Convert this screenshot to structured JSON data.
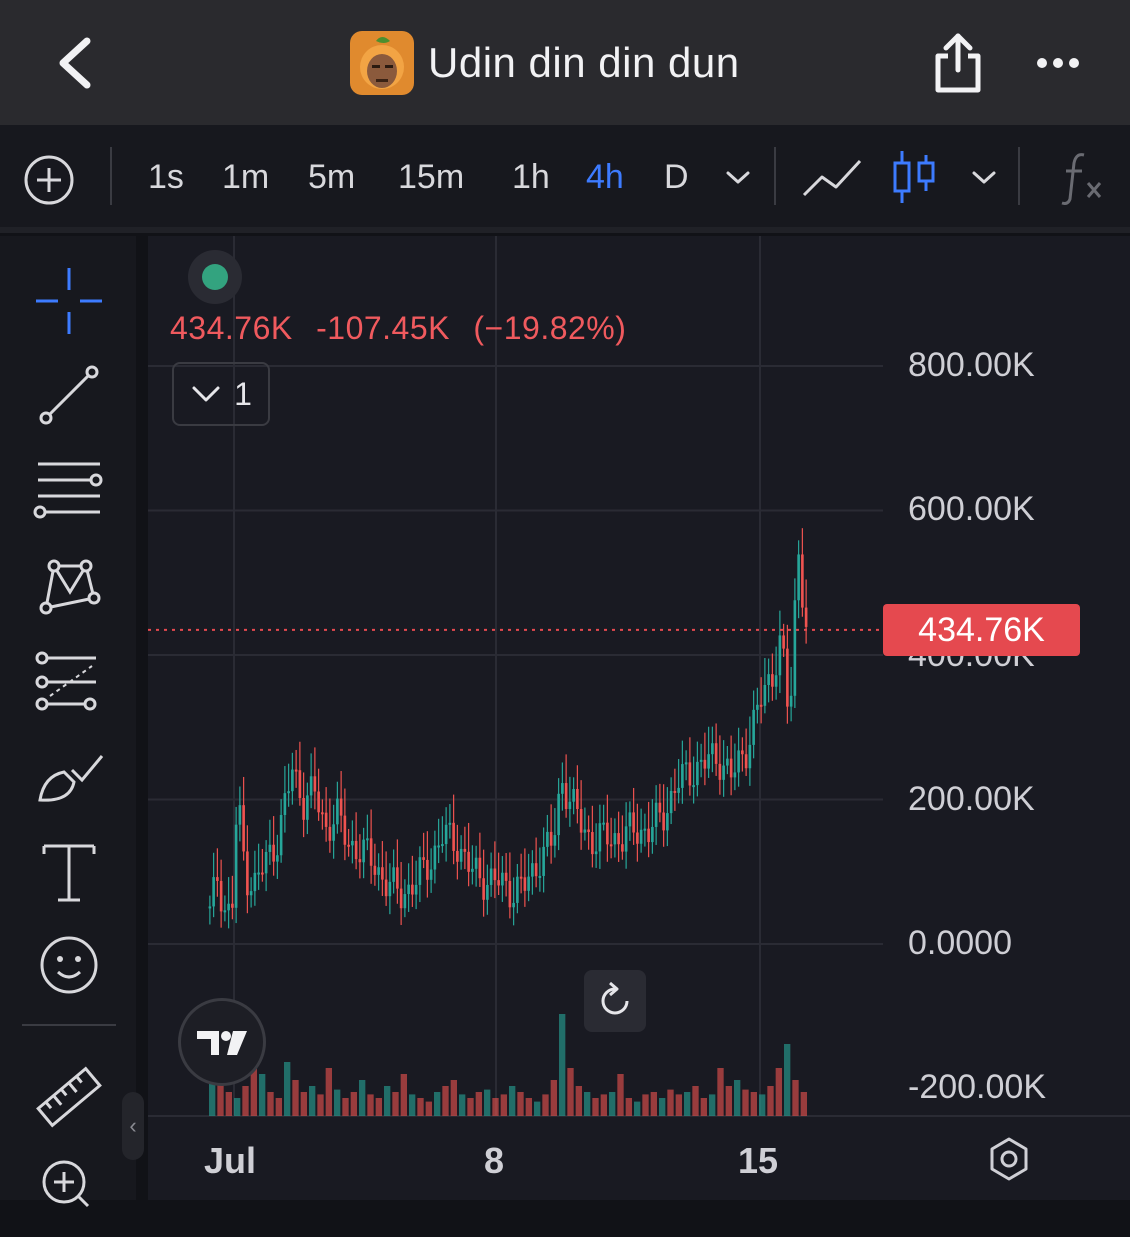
{
  "header": {
    "title": "Udin din din dun"
  },
  "icons": {
    "back": "chevron-left-icon",
    "share": "share-icon",
    "more": "more-dots-icon",
    "add_indicator": "plus-circle-icon",
    "line_chart": "line-chart-icon",
    "candles": "candlestick-icon",
    "formula": "fx-icon"
  },
  "toolbar": {
    "timeframes": [
      "1s",
      "1m",
      "5m",
      "15m",
      "1h",
      "4h",
      "D"
    ],
    "active_timeframe": "4h"
  },
  "left_tools": [
    "crosshair-icon",
    "trend-line-icon",
    "horizontal-lines-icon",
    "pattern-icon",
    "fib-tool-icon",
    "brush-icon",
    "text-tool-icon",
    "emoji-icon",
    "ruler-icon",
    "zoom-in-icon"
  ],
  "legend": {
    "price": "434.76K",
    "change": "-107.45K",
    "change_pct": "(−19.82%)",
    "series_count": "1"
  },
  "colors": {
    "up": "#26a69a",
    "down": "#ef5350",
    "accent": "#3d7bff",
    "price_tag": "#e5494f"
  },
  "chart_data": {
    "type": "candlestick",
    "last_price": 434760,
    "last_price_label": "434.76K",
    "y_ticks": [
      "800.00K",
      "600.00K",
      "400.00K",
      "200.00K",
      "0.0000",
      "-200.00K"
    ],
    "x_ticks": [
      "Jul",
      "8",
      "15"
    ],
    "ylim": [
      -200000,
      800000
    ],
    "close_path": [
      [
        0,
        40000
      ],
      [
        3,
        100000
      ],
      [
        5,
        50000
      ],
      [
        8,
        40000
      ],
      [
        10,
        200000
      ],
      [
        13,
        100000
      ],
      [
        16,
        80000
      ],
      [
        20,
        110000
      ],
      [
        25,
        150000
      ],
      [
        30,
        240000
      ],
      [
        34,
        200000
      ],
      [
        38,
        210000
      ],
      [
        42,
        160000
      ],
      [
        46,
        180000
      ],
      [
        50,
        140000
      ],
      [
        55,
        130000
      ],
      [
        60,
        110000
      ],
      [
        65,
        80000
      ],
      [
        70,
        70000
      ],
      [
        75,
        85000
      ],
      [
        80,
        115000
      ],
      [
        85,
        150000
      ],
      [
        90,
        140000
      ],
      [
        95,
        100000
      ],
      [
        100,
        90000
      ],
      [
        105,
        85000
      ],
      [
        110,
        75000
      ],
      [
        115,
        80000
      ],
      [
        120,
        120000
      ],
      [
        125,
        140000
      ],
      [
        128,
        230000
      ],
      [
        132,
        190000
      ],
      [
        136,
        160000
      ],
      [
        140,
        140000
      ],
      [
        145,
        150000
      ],
      [
        150,
        145000
      ],
      [
        155,
        160000
      ],
      [
        160,
        155000
      ],
      [
        165,
        180000
      ],
      [
        170,
        220000
      ],
      [
        175,
        240000
      ],
      [
        180,
        250000
      ],
      [
        185,
        260000
      ],
      [
        190,
        230000
      ],
      [
        195,
        270000
      ],
      [
        200,
        330000
      ],
      [
        205,
        380000
      ],
      [
        208,
        420000
      ],
      [
        211,
        300000
      ],
      [
        214,
        560000
      ],
      [
        217,
        434760
      ]
    ],
    "volume_heights": [
      0.3,
      0.55,
      0.2,
      0.15,
      0.25,
      0.6,
      0.35,
      0.2,
      0.15,
      0.45,
      0.3,
      0.2,
      0.25,
      0.18,
      0.4,
      0.22,
      0.15,
      0.2,
      0.3,
      0.18,
      0.15,
      0.25,
      0.2,
      0.35,
      0.18,
      0.15,
      0.12,
      0.2,
      0.25,
      0.3,
      0.18,
      0.15,
      0.2,
      0.22,
      0.15,
      0.18,
      0.25,
      0.2,
      0.15,
      0.12,
      0.18,
      0.3,
      0.85,
      0.4,
      0.25,
      0.2,
      0.15,
      0.18,
      0.2,
      0.35,
      0.15,
      0.12,
      0.18,
      0.2,
      0.15,
      0.22,
      0.18,
      0.2,
      0.25,
      0.15,
      0.18,
      0.4,
      0.25,
      0.3,
      0.22,
      0.2,
      0.18,
      0.25,
      0.4,
      0.6,
      0.3,
      0.2
    ]
  }
}
